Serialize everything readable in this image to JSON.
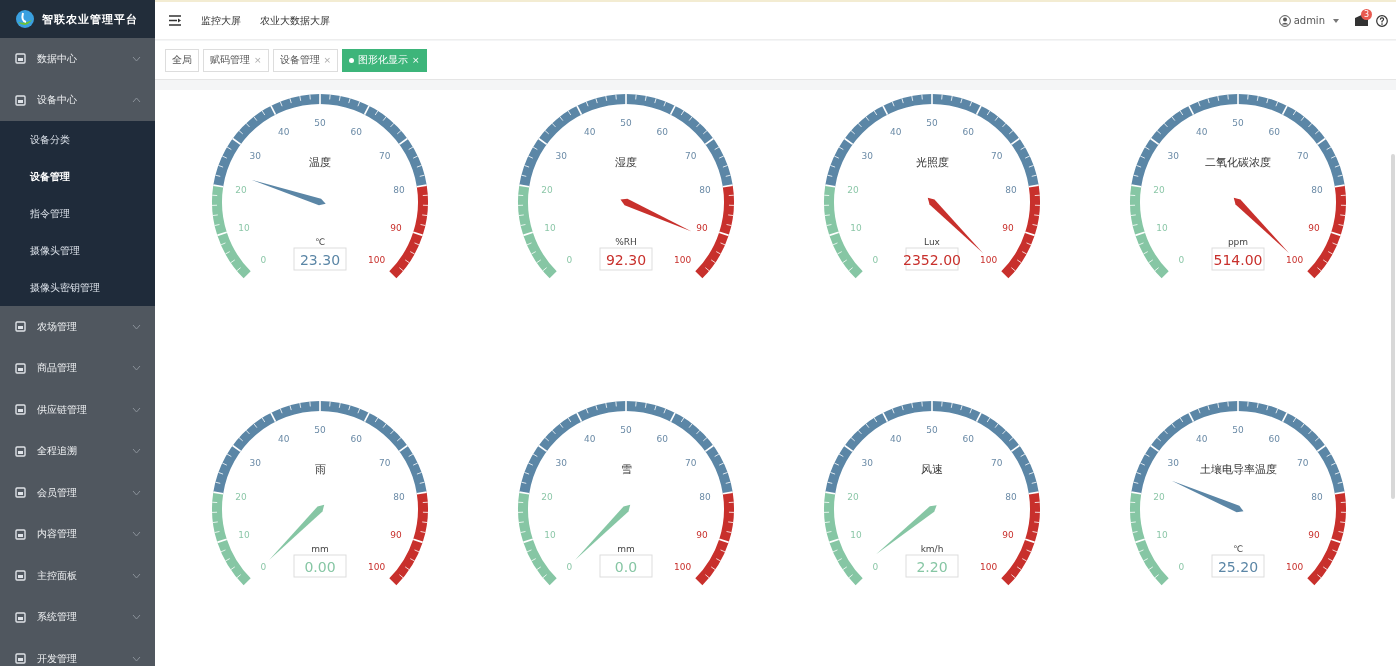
{
  "brand": {
    "title": "智联农业管理平台"
  },
  "header": {
    "links": [
      "监控大屏",
      "农业大数据大屏"
    ],
    "user": "admin",
    "badge": "3"
  },
  "sidebar": {
    "items": [
      {
        "label": "数据中心",
        "expanded": false
      },
      {
        "label": "设备中心",
        "expanded": true,
        "children": [
          {
            "label": "设备分类",
            "selected": false
          },
          {
            "label": "设备管理",
            "selected": true
          },
          {
            "label": "指令管理",
            "selected": false
          },
          {
            "label": "摄像头管理",
            "selected": false
          },
          {
            "label": "摄像头密钥管理",
            "selected": false
          }
        ]
      },
      {
        "label": "农场管理",
        "expanded": false
      },
      {
        "label": "商品管理",
        "expanded": false
      },
      {
        "label": "供应链管理",
        "expanded": false
      },
      {
        "label": "全程追溯",
        "expanded": false
      },
      {
        "label": "会员管理",
        "expanded": false
      },
      {
        "label": "内容管理",
        "expanded": false
      },
      {
        "label": "主控面板",
        "expanded": false
      },
      {
        "label": "系统管理",
        "expanded": false
      },
      {
        "label": "开发管理",
        "expanded": false
      }
    ]
  },
  "tabs": [
    {
      "label": "全局",
      "selected": false
    },
    {
      "label": "赋码管理",
      "selected": false,
      "close": "×"
    },
    {
      "label": "设备管理",
      "selected": false,
      "close": "×"
    },
    {
      "label": "图形化显示",
      "selected": true,
      "close": "×"
    }
  ],
  "gauges": [
    {
      "title": "温度",
      "unit": "℃",
      "value": "23.30",
      "ticks": [
        "0",
        "10",
        "20",
        "30",
        "40",
        "50",
        "60",
        "70",
        "80",
        "90",
        "100"
      ]
    },
    {
      "title": "湿度",
      "unit": "%RH",
      "value": "92.30",
      "ticks": [
        "0",
        "10",
        "20",
        "30",
        "40",
        "50",
        "60",
        "70",
        "80",
        "90",
        "100"
      ]
    },
    {
      "title": "光照度",
      "unit": "Lux",
      "value": "2352.00",
      "ticks": [
        "0",
        "10",
        "20",
        "30",
        "40",
        "50",
        "60",
        "70",
        "80",
        "90",
        "100"
      ]
    },
    {
      "title": "二氧化碳浓度",
      "unit": "ppm",
      "value": "514.00",
      "ticks": [
        "0",
        "10",
        "20",
        "30",
        "40",
        "50",
        "60",
        "70",
        "80",
        "90",
        "100"
      ]
    },
    {
      "title": "雨",
      "unit": "mm",
      "value": "0.00",
      "ticks": [
        "0",
        "10",
        "20",
        "30",
        "40",
        "50",
        "60",
        "70",
        "80",
        "90",
        "100"
      ]
    },
    {
      "title": "雪",
      "unit": "mm",
      "value": "0.0",
      "ticks": [
        "0",
        "10",
        "20",
        "30",
        "40",
        "50",
        "60",
        "70",
        "80",
        "90",
        "100"
      ]
    },
    {
      "title": "风速",
      "unit": "km/h",
      "value": "2.20",
      "ticks": [
        "0",
        "10",
        "20",
        "30",
        "40",
        "50",
        "60",
        "70",
        "80",
        "90",
        "100"
      ]
    },
    {
      "title": "土壤电导率温度",
      "unit": "℃",
      "value": "25.20",
      "ticks": [
        "0",
        "10",
        "20",
        "30",
        "40",
        "50",
        "60",
        "70",
        "80",
        "90",
        "100"
      ]
    }
  ]
}
